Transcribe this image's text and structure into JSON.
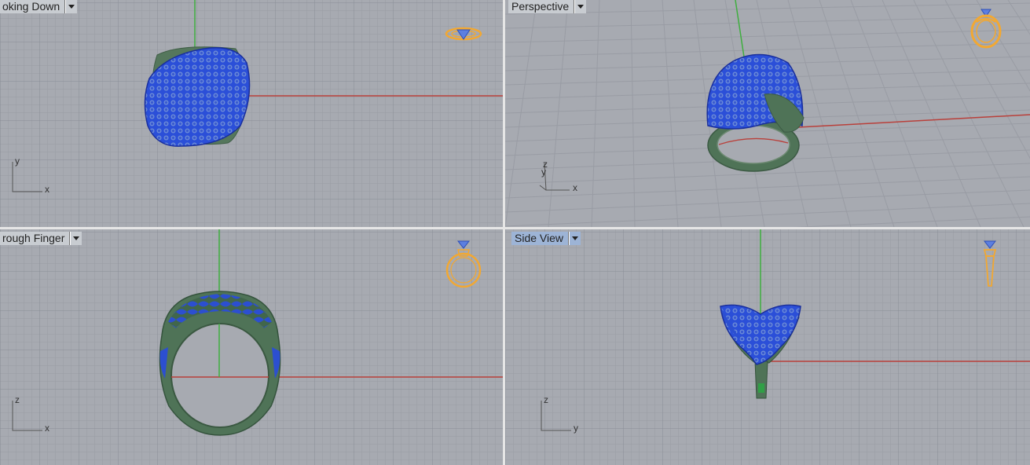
{
  "viewports": {
    "top": {
      "title": "oking Down",
      "axis_h": "x",
      "axis_v": "y"
    },
    "perspective": {
      "title": "Perspective",
      "axis_h": "x",
      "axis_v": "y",
      "axis_z": "z"
    },
    "front": {
      "title": "rough Finger",
      "axis_h": "x",
      "axis_v": "z"
    },
    "side": {
      "title": "Side View",
      "axis_h": "y",
      "axis_v": "z"
    }
  },
  "colors": {
    "background": "#a7aab1",
    "grid_minor": "#9a9ea6",
    "grid_major": "#8b8f97",
    "x_axis": "#b9403b",
    "y_axis": "#3fae3f",
    "ring_shank": "#4f7357",
    "pave_surface": "#2b4fd8",
    "widget": "#f2a832",
    "active_title": "#9db4d6"
  },
  "icons": {
    "dropdown": "chevron-down-icon",
    "widget": "ring-view-icon"
  }
}
